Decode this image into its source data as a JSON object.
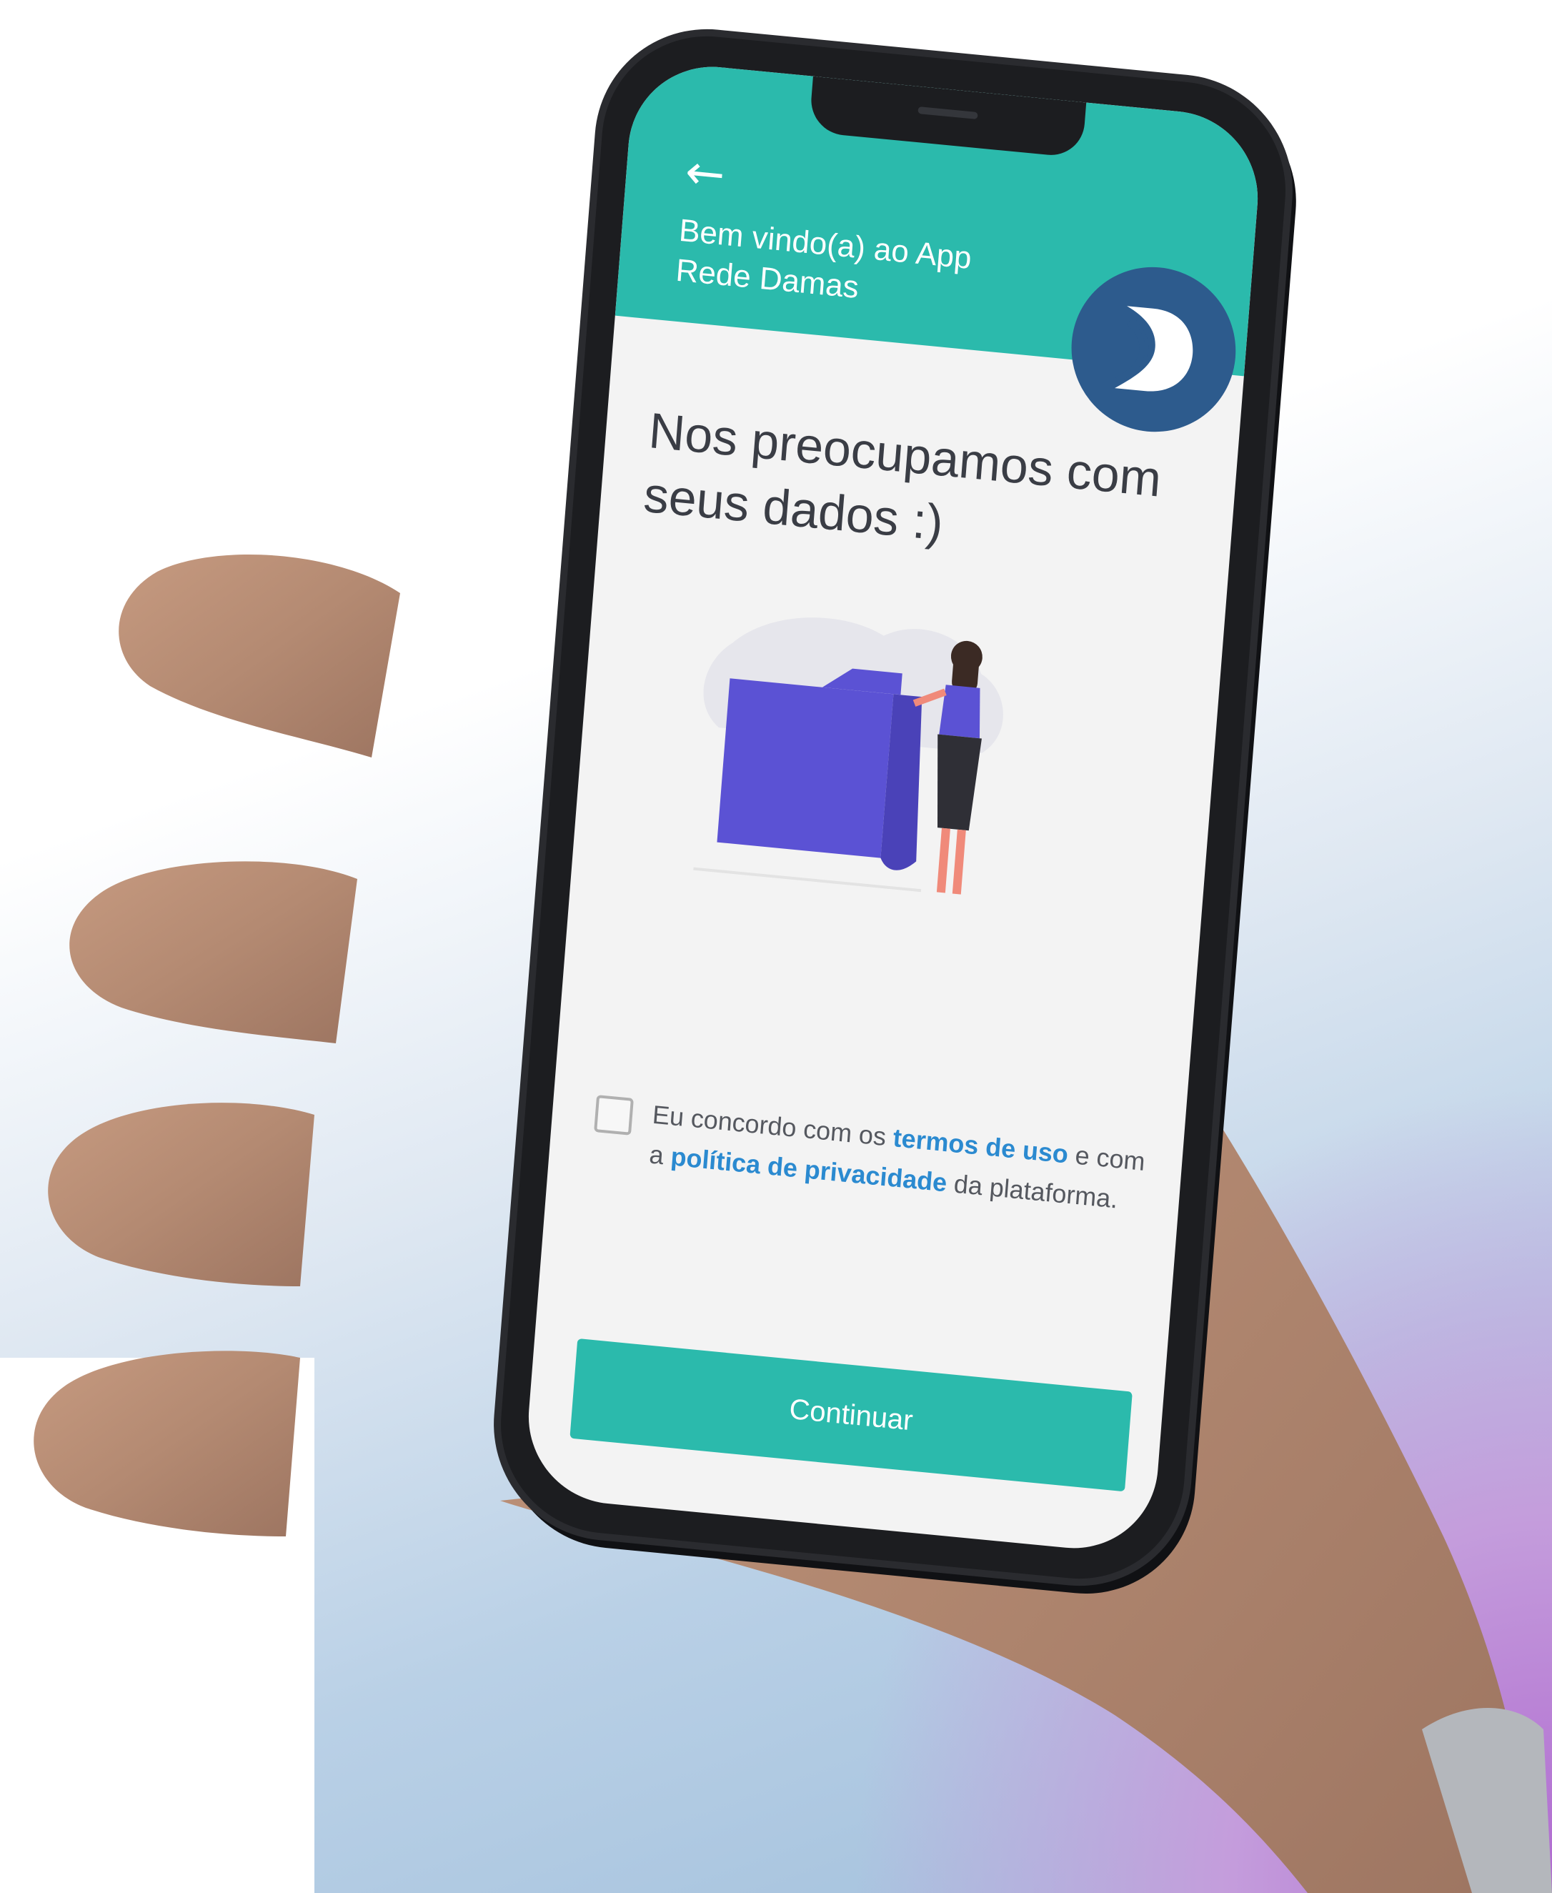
{
  "header": {
    "title_line1": "Bem vindo(a) ao App",
    "title_line2": "Rede Damas",
    "back_icon": "arrow-left-icon",
    "logo_icon": "rede-damas-logo"
  },
  "main": {
    "headline_line1": "Nos preocupamos com",
    "headline_line2": "seus dados :)",
    "illustration": "folder-woman-illustration",
    "consent": {
      "text_1": "Eu concordo com os ",
      "terms_link": "termos de uso",
      "text_2": " e com a ",
      "privacy_link": "política de privacidade",
      "text_3": " da plataforma.",
      "checked": false
    },
    "continue_label": "Continuar"
  },
  "colors": {
    "primary": "#2bbaac",
    "logo_bg": "#2d5b8d",
    "link": "#2b8ad0",
    "folder": "#5b52d4"
  }
}
